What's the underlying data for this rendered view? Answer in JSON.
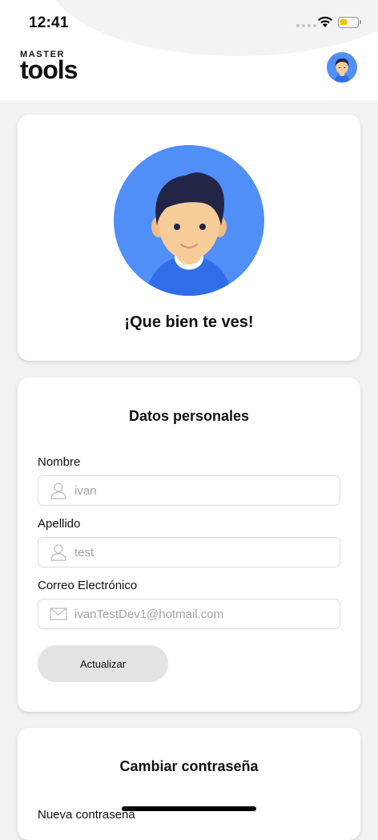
{
  "status_bar": {
    "time": "12:41",
    "wifi_icon": "wifi-icon",
    "battery_icon": "battery-icon",
    "battery_color": "#f2c200"
  },
  "header": {
    "logo_top": "MASTER",
    "logo_bottom": "tools",
    "avatar_icon": "user-avatar-icon"
  },
  "profile": {
    "greeting": "¡Que bien te ves!",
    "avatar_bg": "#4f8ff7"
  },
  "personal": {
    "title": "Datos personales",
    "name_label": "Nombre",
    "name_value": "ivan",
    "name_icon": "user-icon",
    "lastname_label": "Apellido",
    "lastname_value": "test",
    "lastname_icon": "user-icon",
    "email_label": "Correo Electrónico",
    "email_value": "ivanTestDev1@hotmail.com",
    "email_icon": "mail-icon",
    "update_button": "Actualizar"
  },
  "password": {
    "title": "Cambiar contraseña",
    "new_label": "Nueva contraseña"
  }
}
